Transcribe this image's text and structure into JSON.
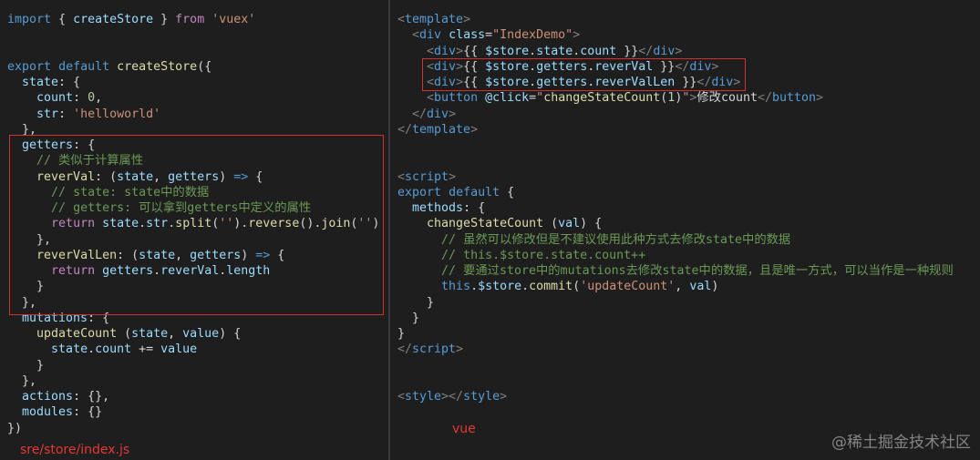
{
  "left_code": [
    [
      [
        "kw",
        "import"
      ],
      [
        "pun",
        " { "
      ],
      [
        "prop",
        "createStore"
      ],
      [
        "pun",
        " } "
      ],
      [
        "ctl",
        "from"
      ],
      [
        "pun",
        " "
      ],
      [
        "str",
        "'vuex'"
      ]
    ],
    [],
    [],
    [
      [
        "kw",
        "export"
      ],
      [
        "pun",
        " "
      ],
      [
        "kw",
        "default"
      ],
      [
        "pun",
        " "
      ],
      [
        "fn",
        "createStore"
      ],
      [
        "pun",
        "({"
      ]
    ],
    [
      [
        "pun",
        "  "
      ],
      [
        "prop",
        "state"
      ],
      [
        "pun",
        ": {"
      ]
    ],
    [
      [
        "pun",
        "    "
      ],
      [
        "prop",
        "count"
      ],
      [
        "pun",
        ": "
      ],
      [
        "num",
        "0"
      ],
      [
        "pun",
        ","
      ]
    ],
    [
      [
        "pun",
        "    "
      ],
      [
        "prop",
        "str"
      ],
      [
        "pun",
        ": "
      ],
      [
        "str",
        "'helloworld'"
      ]
    ],
    [
      [
        "pun",
        "  },"
      ]
    ],
    [
      [
        "pun",
        "  "
      ],
      [
        "prop",
        "getters"
      ],
      [
        "pun",
        ": {"
      ]
    ],
    [
      [
        "pun",
        "    "
      ],
      [
        "cmt",
        "// 类似于计算属性"
      ]
    ],
    [
      [
        "pun",
        "    "
      ],
      [
        "fn",
        "reverVal"
      ],
      [
        "pun",
        ": ("
      ],
      [
        "prop",
        "state"
      ],
      [
        "pun",
        ", "
      ],
      [
        "prop",
        "getters"
      ],
      [
        "pun",
        ") "
      ],
      [
        "kw",
        "=>"
      ],
      [
        "pun",
        " {"
      ]
    ],
    [
      [
        "pun",
        "      "
      ],
      [
        "cmt",
        "// state: state中的数据"
      ]
    ],
    [
      [
        "pun",
        "      "
      ],
      [
        "cmt",
        "// getters: 可以拿到getters中定义的属性"
      ]
    ],
    [
      [
        "pun",
        "      "
      ],
      [
        "ctl",
        "return"
      ],
      [
        "pun",
        " "
      ],
      [
        "prop",
        "state"
      ],
      [
        "pun",
        "."
      ],
      [
        "prop",
        "str"
      ],
      [
        "pun",
        "."
      ],
      [
        "fn",
        "split"
      ],
      [
        "pun",
        "("
      ],
      [
        "str",
        "''"
      ],
      [
        "pun",
        ")."
      ],
      [
        "fn",
        "reverse"
      ],
      [
        "pun",
        "()."
      ],
      [
        "fn",
        "join"
      ],
      [
        "pun",
        "("
      ],
      [
        "str",
        "''"
      ],
      [
        "pun",
        ")"
      ]
    ],
    [
      [
        "pun",
        "    },"
      ]
    ],
    [
      [
        "pun",
        "    "
      ],
      [
        "fn",
        "reverValLen"
      ],
      [
        "pun",
        ": ("
      ],
      [
        "prop",
        "state"
      ],
      [
        "pun",
        ", "
      ],
      [
        "prop",
        "getters"
      ],
      [
        "pun",
        ") "
      ],
      [
        "kw",
        "=>"
      ],
      [
        "pun",
        " {"
      ]
    ],
    [
      [
        "pun",
        "      "
      ],
      [
        "ctl",
        "return"
      ],
      [
        "pun",
        " "
      ],
      [
        "prop",
        "getters"
      ],
      [
        "pun",
        "."
      ],
      [
        "prop",
        "reverVal"
      ],
      [
        "pun",
        "."
      ],
      [
        "prop",
        "length"
      ]
    ],
    [
      [
        "pun",
        "    }"
      ]
    ],
    [
      [
        "pun",
        "  },"
      ]
    ],
    [
      [
        "pun",
        "  "
      ],
      [
        "prop",
        "mutations"
      ],
      [
        "pun",
        ": {"
      ]
    ],
    [
      [
        "pun",
        "    "
      ],
      [
        "fn",
        "updateCount"
      ],
      [
        "pun",
        " ("
      ],
      [
        "prop",
        "state"
      ],
      [
        "pun",
        ", "
      ],
      [
        "prop",
        "value"
      ],
      [
        "pun",
        ") {"
      ]
    ],
    [
      [
        "pun",
        "      "
      ],
      [
        "prop",
        "state"
      ],
      [
        "pun",
        "."
      ],
      [
        "prop",
        "count"
      ],
      [
        "pun",
        " += "
      ],
      [
        "prop",
        "value"
      ]
    ],
    [
      [
        "pun",
        "    }"
      ]
    ],
    [
      [
        "pun",
        "  },"
      ]
    ],
    [
      [
        "pun",
        "  "
      ],
      [
        "prop",
        "actions"
      ],
      [
        "pun",
        ": {},"
      ]
    ],
    [
      [
        "pun",
        "  "
      ],
      [
        "prop",
        "modules"
      ],
      [
        "pun",
        ": {}"
      ]
    ],
    [
      [
        "pun",
        "})"
      ]
    ]
  ],
  "right_code": [
    [
      [
        "tagp",
        "<"
      ],
      [
        "tag",
        "template"
      ],
      [
        "tagp",
        ">"
      ]
    ],
    [
      [
        "pun",
        "  "
      ],
      [
        "tagp",
        "<"
      ],
      [
        "tag",
        "div"
      ],
      [
        "pun",
        " "
      ],
      [
        "attr",
        "class"
      ],
      [
        "pun",
        "="
      ],
      [
        "str",
        "\"IndexDemo\""
      ],
      [
        "tagp",
        ">"
      ]
    ],
    [
      [
        "pun",
        "    "
      ],
      [
        "tagp",
        "<"
      ],
      [
        "tag",
        "div"
      ],
      [
        "tagp",
        ">"
      ],
      [
        "txt",
        "{{ "
      ],
      [
        "prop",
        "$store"
      ],
      [
        "pun",
        "."
      ],
      [
        "prop",
        "state"
      ],
      [
        "pun",
        "."
      ],
      [
        "prop",
        "count"
      ],
      [
        "txt",
        " }}"
      ],
      [
        "tagp",
        "</"
      ],
      [
        "tag",
        "div"
      ],
      [
        "tagp",
        ">"
      ]
    ],
    [
      [
        "pun",
        "    "
      ],
      [
        "tagp",
        "<"
      ],
      [
        "tag",
        "div"
      ],
      [
        "tagp",
        ">"
      ],
      [
        "txt",
        "{{ "
      ],
      [
        "prop",
        "$store"
      ],
      [
        "pun",
        "."
      ],
      [
        "prop",
        "getters"
      ],
      [
        "pun",
        "."
      ],
      [
        "prop",
        "reverVal"
      ],
      [
        "txt",
        " }}"
      ],
      [
        "tagp",
        "</"
      ],
      [
        "tag",
        "div"
      ],
      [
        "tagp",
        ">"
      ]
    ],
    [
      [
        "pun",
        "    "
      ],
      [
        "tagp",
        "<"
      ],
      [
        "tag",
        "div"
      ],
      [
        "tagp",
        ">"
      ],
      [
        "txt",
        "{{ "
      ],
      [
        "prop",
        "$store"
      ],
      [
        "pun",
        "."
      ],
      [
        "prop",
        "getters"
      ],
      [
        "pun",
        "."
      ],
      [
        "prop",
        "reverValLen"
      ],
      [
        "txt",
        " }}"
      ],
      [
        "tagp",
        "</"
      ],
      [
        "tag",
        "div"
      ],
      [
        "tagp",
        ">"
      ]
    ],
    [
      [
        "pun",
        "    "
      ],
      [
        "tagp",
        "<"
      ],
      [
        "tag",
        "button"
      ],
      [
        "pun",
        " "
      ],
      [
        "attr",
        "@click"
      ],
      [
        "pun",
        "="
      ],
      [
        "str",
        "\""
      ],
      [
        "fn",
        "changeStateCount"
      ],
      [
        "pun",
        "("
      ],
      [
        "num",
        "1"
      ],
      [
        "pun",
        ")"
      ],
      [
        "str",
        "\""
      ],
      [
        "tagp",
        ">"
      ],
      [
        "txt",
        "修改count"
      ],
      [
        "tagp",
        "</"
      ],
      [
        "tag",
        "button"
      ],
      [
        "tagp",
        ">"
      ]
    ],
    [
      [
        "pun",
        "  "
      ],
      [
        "tagp",
        "</"
      ],
      [
        "tag",
        "div"
      ],
      [
        "tagp",
        ">"
      ]
    ],
    [
      [
        "tagp",
        "</"
      ],
      [
        "tag",
        "template"
      ],
      [
        "tagp",
        ">"
      ]
    ],
    [],
    [],
    [
      [
        "tagp",
        "<"
      ],
      [
        "tag",
        "script"
      ],
      [
        "tagp",
        ">"
      ]
    ],
    [
      [
        "kw",
        "export"
      ],
      [
        "pun",
        " "
      ],
      [
        "kw",
        "default"
      ],
      [
        "pun",
        " {"
      ]
    ],
    [
      [
        "pun",
        "  "
      ],
      [
        "prop",
        "methods"
      ],
      [
        "pun",
        ": {"
      ]
    ],
    [
      [
        "pun",
        "    "
      ],
      [
        "fn",
        "changeStateCount"
      ],
      [
        "pun",
        " ("
      ],
      [
        "prop",
        "val"
      ],
      [
        "pun",
        ") {"
      ]
    ],
    [
      [
        "pun",
        "      "
      ],
      [
        "cmt",
        "// 虽然可以修改但是不建议使用此种方式去修改state中的数据"
      ]
    ],
    [
      [
        "pun",
        "      "
      ],
      [
        "cmt",
        "// this.$store.state.count++"
      ]
    ],
    [
      [
        "pun",
        "      "
      ],
      [
        "cmt",
        "// 要通过store中的mutations去修改state中的数据，且是唯一方式，可以当作是一种规则"
      ]
    ],
    [
      [
        "pun",
        "      "
      ],
      [
        "kw",
        "this"
      ],
      [
        "pun",
        "."
      ],
      [
        "prop",
        "$store"
      ],
      [
        "pun",
        "."
      ],
      [
        "fn",
        "commit"
      ],
      [
        "pun",
        "("
      ],
      [
        "str",
        "'updateCount'"
      ],
      [
        "pun",
        ", "
      ],
      [
        "prop",
        "val"
      ],
      [
        "pun",
        ")"
      ]
    ],
    [
      [
        "pun",
        "    }"
      ]
    ],
    [
      [
        "pun",
        "  }"
      ]
    ],
    [
      [
        "pun",
        "}"
      ]
    ],
    [
      [
        "tagp",
        "</"
      ],
      [
        "tag",
        "script"
      ],
      [
        "tagp",
        ">"
      ]
    ],
    [],
    [],
    [
      [
        "tagp",
        "<"
      ],
      [
        "tag",
        "style"
      ],
      [
        "tagp",
        "></"
      ],
      [
        "tag",
        "style"
      ],
      [
        "tagp",
        ">"
      ]
    ]
  ],
  "captions": {
    "left_file": "sre/store/index.js",
    "right_file": "vue"
  },
  "watermark": "@稀土掘金技术社区",
  "colors": {
    "background": "#1e1e1e",
    "highlight_border": "#d32f2f",
    "caption": "#e53935"
  }
}
